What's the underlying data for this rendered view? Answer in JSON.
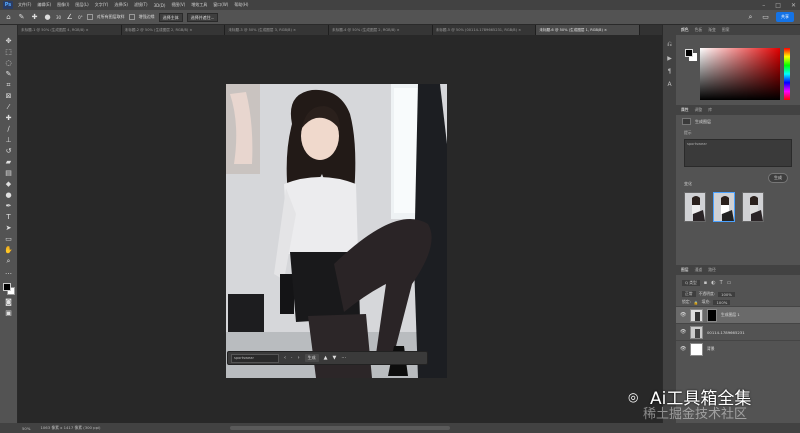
{
  "menubar": {
    "logo": "Ps",
    "items": [
      "文件(F)",
      "编辑(E)",
      "图像(I)",
      "图层(L)",
      "文字(Y)",
      "选择(S)",
      "滤镜(T)",
      "3D(D)",
      "视图(V)",
      "增效工具",
      "窗口(W)",
      "帮助(H)"
    ]
  },
  "options": {
    "size": "30",
    "angle": "0°",
    "check_label": "对所有图层取样",
    "enhance": "增强边缘",
    "subject_btn": "选择主体",
    "refine_btn": "选择并遮住...",
    "share": "共享"
  },
  "tabs": [
    {
      "label": "未标题-1 @ 50% (生成图层 4, RGB/8) ×",
      "active": false
    },
    {
      "label": "未标题-2 @ 50% (生成图层 2, RGB/8) ×",
      "active": false
    },
    {
      "label": "未标题-3 @ 50% (生成图层 3, RGB/8) ×",
      "active": false
    },
    {
      "label": "未标题-4 @ 50% (生成图层 2, RGB/8) ×",
      "active": false
    },
    {
      "label": "未标题-5 @ 50% (00114-1789665231, RGB/8) ×",
      "active": false
    },
    {
      "label": "未标题-6 @ 50% (生成图层 1, RGB/8) ×",
      "active": true
    }
  ],
  "context_bar": {
    "prompt": "sportswear",
    "generate": "生成"
  },
  "status": {
    "zoom": "50%",
    "doc": "1063 像素 x 1417 像素 (300 ppi)"
  },
  "panels": {
    "color_tabs": [
      "颜色",
      "色板",
      "渐变",
      "图案"
    ],
    "props_tabs": [
      "属性",
      "调整",
      "库"
    ],
    "props_layer_type": "生成图层",
    "props_prompt_label": "提示",
    "props_prompt_value": "sportswear",
    "props_generate": "生成",
    "props_variants_title": "变化",
    "layers_tabs": [
      "图层",
      "通道",
      "路径"
    ],
    "kind": "Q 类型",
    "blend": "正常",
    "opacity_label": "不透明度:",
    "opacity": "100%",
    "lock_label": "锁定:",
    "fill_label": "填充:",
    "fill": "100%",
    "layers": [
      {
        "name": "生成图层 1",
        "selected": true
      },
      {
        "name": "00114-1789665231",
        "selected": false
      },
      {
        "name": "背景",
        "selected": false
      }
    ]
  },
  "watermark": {
    "title": "Ai工具箱全集",
    "sub": "稀土掘金技术社区"
  },
  "colors": {
    "accent": "#1473e6",
    "panel": "#535353",
    "canvas": "#282828"
  }
}
